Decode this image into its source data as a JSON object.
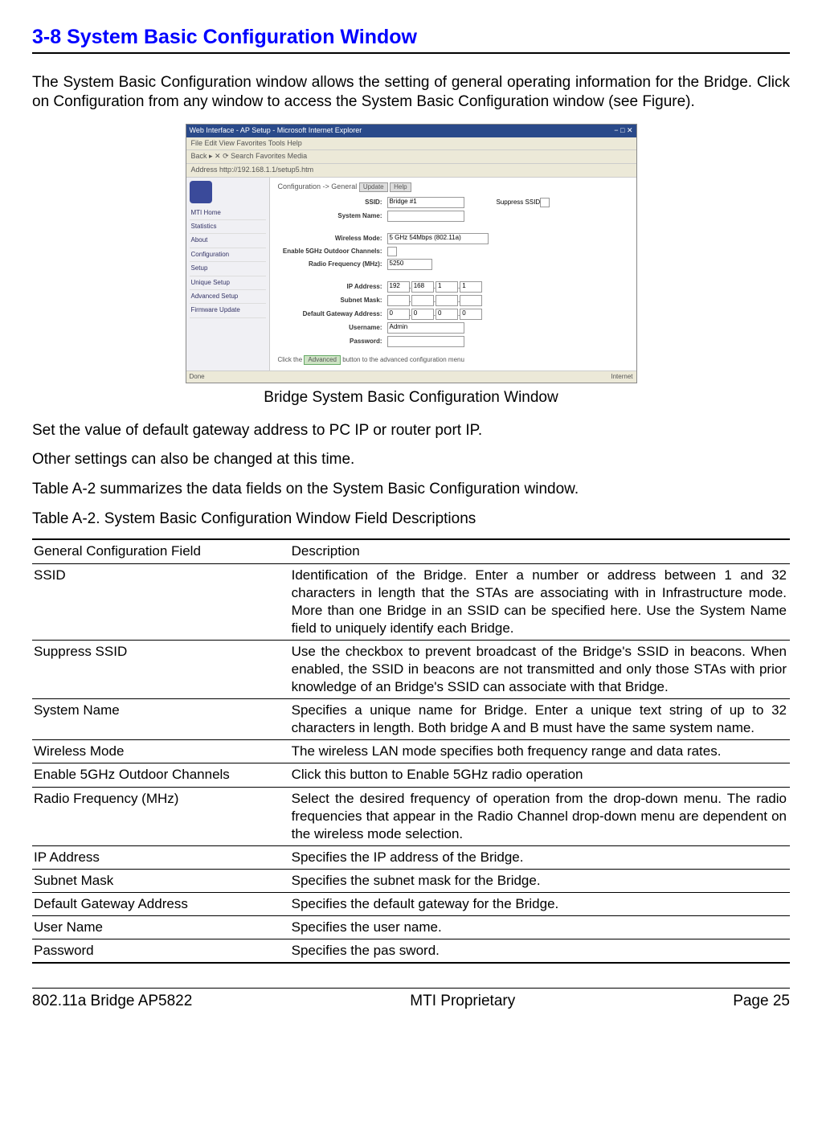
{
  "heading": "3-8 System Basic Configuration Window",
  "intro": "The System Basic Configuration window allows the setting of general operating information for the Bridge. Click on Configuration from any window to access the System Basic Configuration window (see Figure).",
  "figure": {
    "title": "Web Interface - AP Setup - Microsoft Internet Explorer",
    "menu": "File  Edit  View  Favorites  Tools  Help",
    "toolbar": "Back  ▸  ✕  ⟳  Search  Favorites  Media",
    "address_label": "Address",
    "address_value": "http://192.168.1.1/setup5.htm",
    "sidebar": {
      "brand": "MTI Home",
      "items": [
        "Statistics",
        "About",
        "Configuration",
        "Setup",
        "Unique Setup",
        "Advanced Setup",
        "Firmware Update"
      ]
    },
    "breadcrumb": "Configuration -> General",
    "btn_update": "Update",
    "btn_help": "Help",
    "fields": {
      "ssid_label": "SSID:",
      "ssid_value": "Bridge #1",
      "suppress_label": "Suppress SSID",
      "sysname_label": "System Name:",
      "wmode_label": "Wireless Mode:",
      "wmode_value": "5 GHz 54Mbps (802.11a)",
      "enable5_label": "Enable 5GHz Outdoor Channels:",
      "rf_label": "Radio Frequency (MHz):",
      "rf_value": "5250",
      "ip_label": "IP Address:",
      "ip_v1": "192",
      "ip_v2": "168",
      "ip_v3": "1",
      "ip_v4": "1",
      "mask_label": "Subnet Mask:",
      "gw_label": "Default Gateway Address:",
      "gw_v1": "0",
      "gw_v2": "0",
      "gw_v3": "0",
      "gw_v4": "0",
      "user_label": "Username:",
      "user_value": "Admin",
      "pw_label": "Password:"
    },
    "hint_pre": "Click the",
    "hint_btn": "Advanced",
    "hint_post": "button to the advanced configuration menu",
    "status_left": "Done",
    "status_right": "Internet"
  },
  "figure_caption": "Bridge System Basic Configuration Window",
  "para1": "Set the value of default gateway address to PC IP or router port IP.",
  "para2": "Other settings can also be changed at this time.",
  "para3": "Table A-2 summarizes the data fields on the System Basic Configuration window.",
  "table_title": "Table A-2. System Basic Configuration Window Field Descriptions",
  "table": {
    "head_field": "General Configuration Field",
    "head_desc": "Description",
    "rows": [
      {
        "f": "SSID",
        "d": "Identification of the Bridge. Enter a number or address between 1 and 32 characters in length that the STAs are associating with in Infrastructure mode. More than one Bridge in an SSID can be specified here. Use the System Name field to uniquely identify each Bridge."
      },
      {
        "f": "Suppress SSID",
        "d": "Use the checkbox to prevent broadcast of the Bridge's SSID in beacons. When enabled, the SSID in beacons are not transmitted and only those STAs with prior knowledge of an Bridge's SSID can associate with that Bridge."
      },
      {
        "f": "System Name",
        "d": "Specifies a unique name for Bridge. Enter a unique text string of up to 32 characters in length. Both bridge A and B must have the same system name."
      },
      {
        "f": "Wireless Mode",
        "d": "The wireless LAN mode specifies both frequency range and data rates."
      },
      {
        "f": "Enable 5GHz Outdoor Channels",
        "d": "Click this button to Enable 5GHz radio operation"
      },
      {
        "f": "Radio Frequency (MHz)",
        "d": "Select the desired frequency of operation from the drop-down menu. The radio frequencies that appear in the Radio Channel drop-down menu are dependent on the wireless mode selection."
      },
      {
        "f": "IP Address",
        "d": "Specifies the IP address of the Bridge."
      },
      {
        "f": "Subnet Mask",
        "d": "Specifies the subnet mask for the Bridge."
      },
      {
        "f": "Default Gateway Address",
        "d": "Specifies the default gateway for the Bridge."
      },
      {
        "f": "User Name",
        "d": "Specifies the user name."
      },
      {
        "f": "Password",
        "d": "Specifies the pas sword."
      }
    ]
  },
  "footer": {
    "left": "802.11a Bridge AP5822",
    "center": "MTI Proprietary",
    "right": "Page 25"
  }
}
